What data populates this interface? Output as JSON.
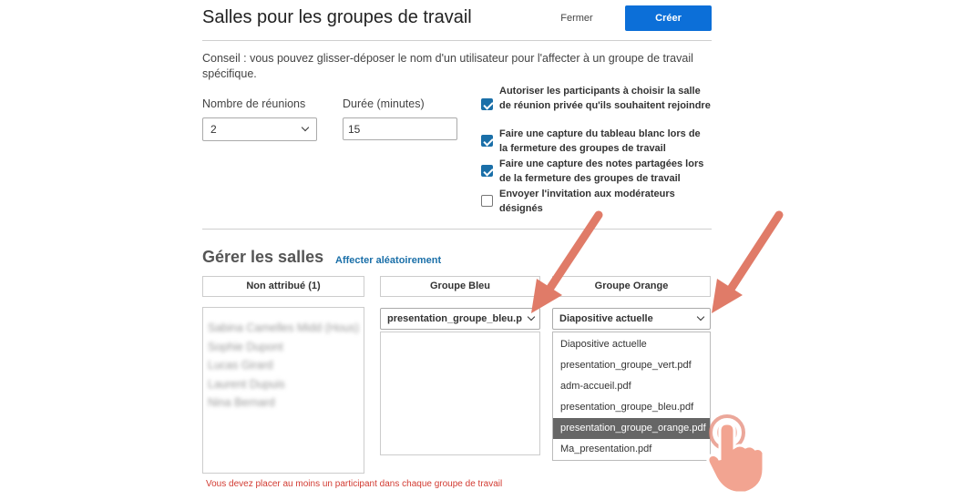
{
  "dialog": {
    "title": "Salles pour les groupes de travail",
    "close_label": "Fermer",
    "create_label": "Créer",
    "tip": "Conseil : vous pouvez glisser-déposer le nom d'un utilisateur pour l'affecter à un groupe de travail spécifique."
  },
  "settings": {
    "meetings_label": "Nombre de réunions",
    "meetings_value": "2",
    "duration_label": "Durée (minutes)",
    "duration_value": "15",
    "options": [
      {
        "label": "Autoriser les participants à choisir la salle de réunion privée qu'ils souhaitent rejoindre",
        "checked": true
      },
      {
        "label": "Faire une capture du tableau blanc lors de la fermeture des groupes de travail",
        "checked": true
      },
      {
        "label": "Faire une capture des notes partagées lors de la fermeture des groupes de travail",
        "checked": true
      },
      {
        "label": "Envoyer l'invitation aux modérateurs désignés",
        "checked": false
      }
    ]
  },
  "rooms": {
    "title": "Gérer les salles",
    "random_link": "Affecter aléatoirement",
    "columns": [
      {
        "name": "Non attribué (1)"
      },
      {
        "name": "Groupe Bleu",
        "presentation": "presentation_groupe_bleu.p"
      },
      {
        "name": "Groupe Orange",
        "presentation": "Diapositive actuelle"
      }
    ],
    "unassigned": [
      "Sabina Camelles Midd (Hous)",
      "Sophie Dupont",
      "Lucas Girard",
      "Laurent Dupuis",
      "Nina Bernard"
    ],
    "dropdown_options": [
      "Diapositive actuelle",
      "presentation_groupe_vert.pdf",
      "adm-accueil.pdf",
      "presentation_groupe_bleu.pdf",
      "presentation_groupe_orange.pdf",
      "Ma_presentation.pdf"
    ],
    "dropdown_highlighted": "presentation_groupe_orange.pdf",
    "error": "Vous devez placer au moins un participant dans chaque groupe de travail"
  },
  "colors": {
    "accent": "#0c6fd8",
    "checkbox": "#1a6fa8",
    "error": "#d23b32",
    "arrow": "#e07b68"
  }
}
